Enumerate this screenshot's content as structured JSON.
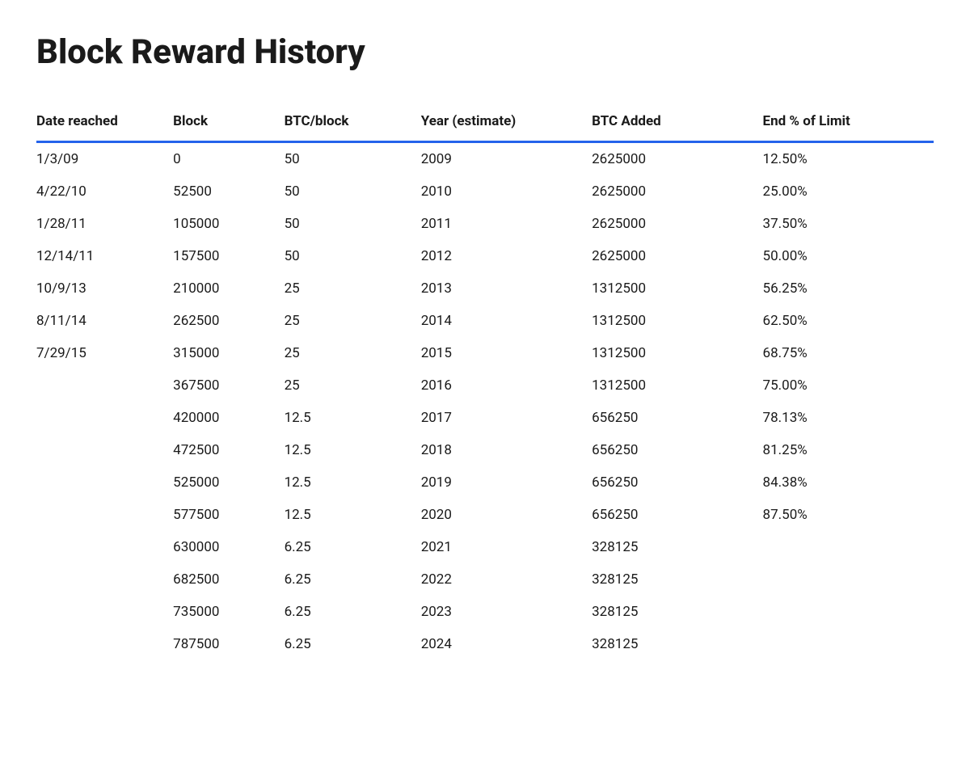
{
  "title": "Block Reward History",
  "table": {
    "headers": {
      "date": "Date reached",
      "block": "Block",
      "btcblock": "BTC/block",
      "year": "Year (estimate)",
      "btcadded": "BTC Added",
      "endlimit": "End % of Limit"
    },
    "rows": [
      {
        "date": "1/3/09",
        "block": "0",
        "btcblock": "50",
        "year": "2009",
        "btcadded": "2625000",
        "endlimit": "12.50%"
      },
      {
        "date": "4/22/10",
        "block": "52500",
        "btcblock": "50",
        "year": "2010",
        "btcadded": "2625000",
        "endlimit": "25.00%"
      },
      {
        "date": "1/28/11",
        "block": "105000",
        "btcblock": "50",
        "year": "2011",
        "btcadded": "2625000",
        "endlimit": "37.50%"
      },
      {
        "date": "12/14/11",
        "block": "157500",
        "btcblock": "50",
        "year": "2012",
        "btcadded": "2625000",
        "endlimit": "50.00%"
      },
      {
        "date": "10/9/13",
        "block": "210000",
        "btcblock": "25",
        "year": "2013",
        "btcadded": "1312500",
        "endlimit": "56.25%"
      },
      {
        "date": "8/11/14",
        "block": "262500",
        "btcblock": "25",
        "year": "2014",
        "btcadded": "1312500",
        "endlimit": "62.50%"
      },
      {
        "date": "7/29/15",
        "block": "315000",
        "btcblock": "25",
        "year": "2015",
        "btcadded": "1312500",
        "endlimit": "68.75%"
      },
      {
        "date": "",
        "block": "367500",
        "btcblock": "25",
        "year": "2016",
        "btcadded": "1312500",
        "endlimit": "75.00%"
      },
      {
        "date": "",
        "block": "420000",
        "btcblock": "12.5",
        "year": "2017",
        "btcadded": "656250",
        "endlimit": "78.13%"
      },
      {
        "date": "",
        "block": "472500",
        "btcblock": "12.5",
        "year": "2018",
        "btcadded": "656250",
        "endlimit": "81.25%"
      },
      {
        "date": "",
        "block": "525000",
        "btcblock": "12.5",
        "year": "2019",
        "btcadded": "656250",
        "endlimit": "84.38%"
      },
      {
        "date": "",
        "block": "577500",
        "btcblock": "12.5",
        "year": "2020",
        "btcadded": "656250",
        "endlimit": "87.50%"
      },
      {
        "date": "",
        "block": "630000",
        "btcblock": "6.25",
        "year": "2021",
        "btcadded": "328125",
        "endlimit": ""
      },
      {
        "date": "",
        "block": "682500",
        "btcblock": "6.25",
        "year": "2022",
        "btcadded": "328125",
        "endlimit": ""
      },
      {
        "date": "",
        "block": "735000",
        "btcblock": "6.25",
        "year": "2023",
        "btcadded": "328125",
        "endlimit": ""
      },
      {
        "date": "",
        "block": "787500",
        "btcblock": "6.25",
        "year": "2024",
        "btcadded": "328125",
        "endlimit": ""
      }
    ]
  }
}
